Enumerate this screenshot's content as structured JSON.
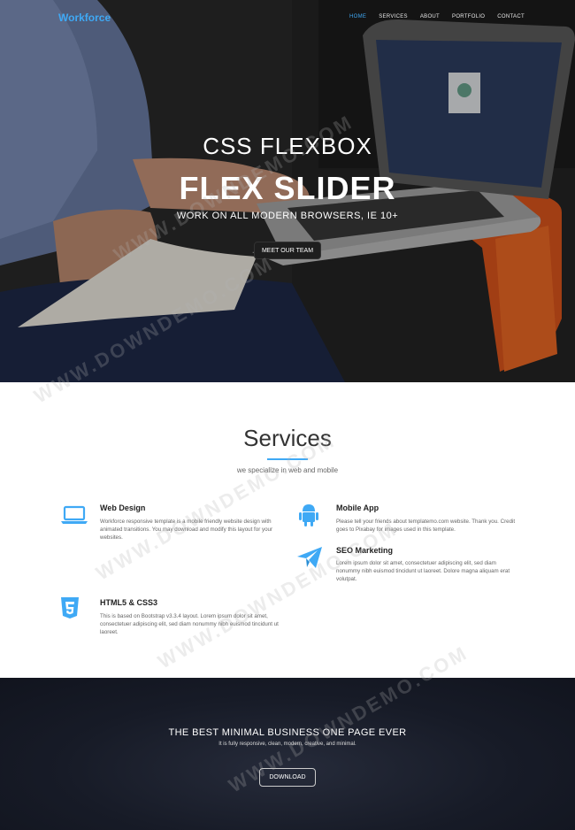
{
  "header": {
    "brand": "Workforce",
    "nav": [
      "HOME",
      "SERVICES",
      "ABOUT",
      "PORTFOLIO",
      "CONTACT"
    ]
  },
  "hero": {
    "subtitle": "CSS FLEXBOX",
    "title": "FLEX SLIDER",
    "tagline": "WORK ON ALL MODERN BROWSERS, IE 10+",
    "button": "MEET OUR TEAM"
  },
  "services": {
    "title": "Services",
    "subtitle": "we specialize in web and mobile",
    "items": [
      {
        "title": "Web Design",
        "icon": "laptop-icon",
        "text": "Workforce responsive template is a mobile friendly website design with animated transitions. You may download and modify this layout for your websites."
      },
      {
        "title": "Mobile App",
        "icon": "android-icon",
        "text": "Please tell your friends about templatemo.com website. Thank you. Credit goes to Pixabay for images used in this template."
      },
      {
        "title": "SEO Marketing",
        "icon": "paper-plane-icon",
        "text": "Lorem ipsum dolor sit amet, consectetuer adipiscing elit, sed diam nonummy nibh euismod tincidunt ut laoreet. Dolore magna aliquam erat volutpat."
      },
      {
        "title": "HTML5 & CSS3",
        "icon": "html5-icon",
        "text": "This is based on Bootstrap v3.3.4 layout. Lorem ipsum dolor sit amet, consectetuer adipiscing elit, sed diam nonummy nibh euismod tincidunt ut laoreet."
      }
    ]
  },
  "banner": {
    "title": "THE BEST MINIMAL BUSINESS ONE PAGE EVER",
    "subtitle": "It is fully responsive, clean, modern, creative, and minimal.",
    "button": "DOWNLOAD"
  },
  "watermark": "WWW.DOWNDEMO.COM",
  "colors": {
    "accent": "#3fa9f5",
    "banner_bg": "#171b27"
  }
}
